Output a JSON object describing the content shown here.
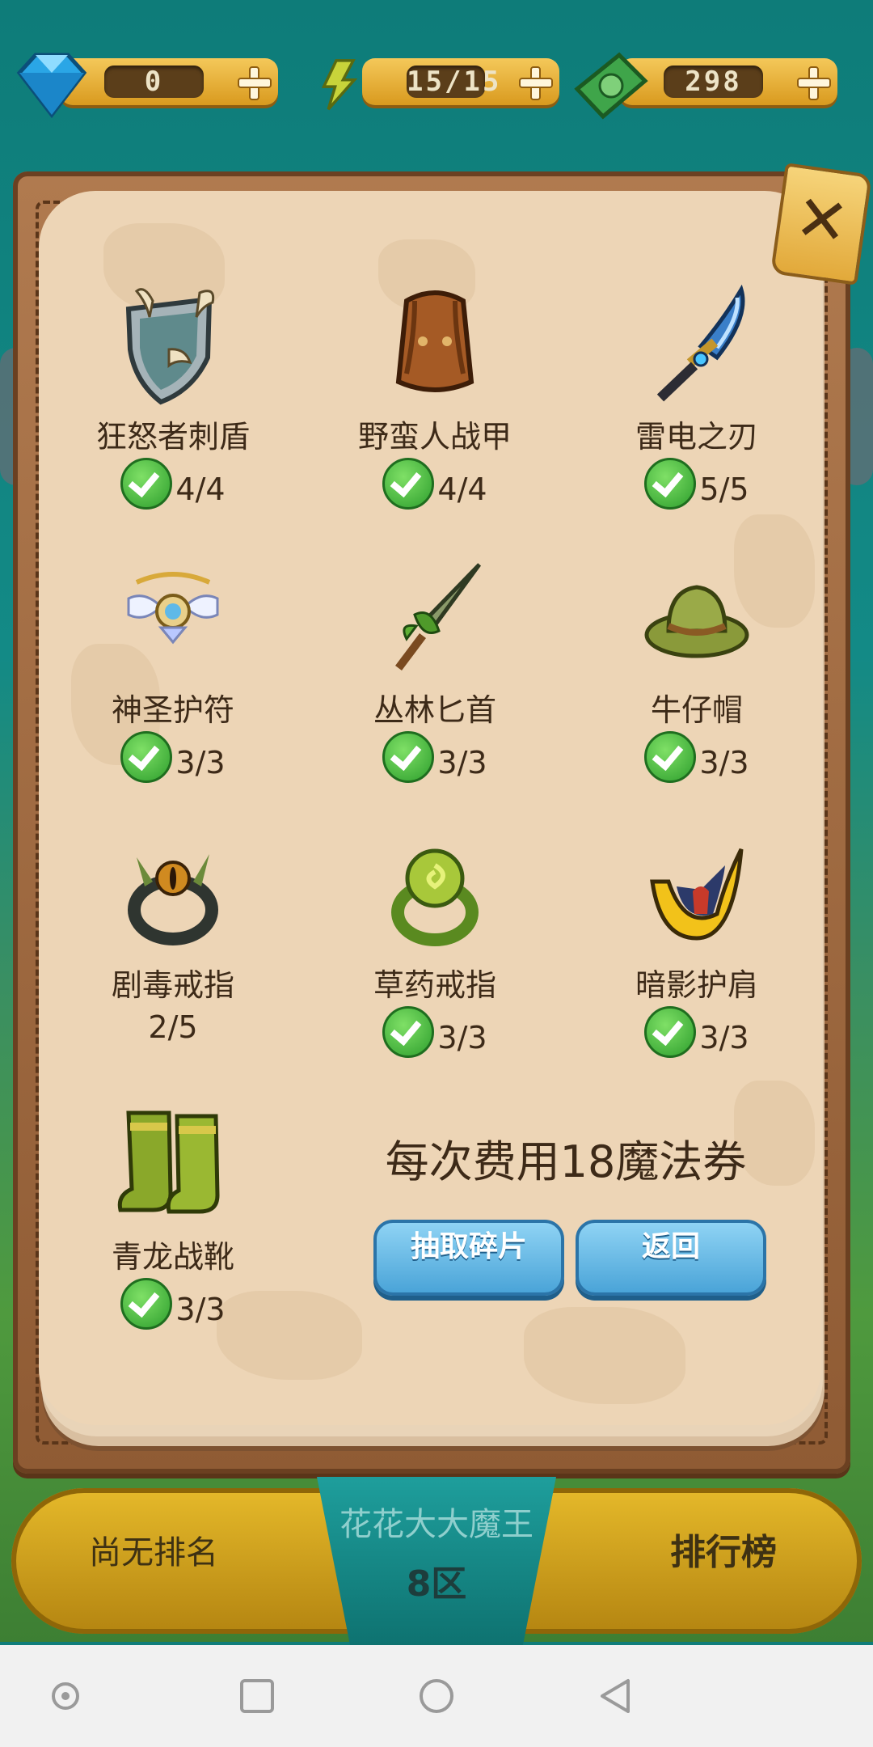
{
  "currencies": {
    "gems": "0",
    "energy": "15/15",
    "cash": "298"
  },
  "items": [
    {
      "name": "狂怒者刺盾",
      "progress": "4/4",
      "complete": true,
      "icon": "spiked-shield-icon"
    },
    {
      "name": "野蛮人战甲",
      "progress": "4/4",
      "complete": true,
      "icon": "leather-armor-icon"
    },
    {
      "name": "雷电之刃",
      "progress": "5/5",
      "complete": true,
      "icon": "lightning-blade-icon"
    },
    {
      "name": "神圣护符",
      "progress": "3/3",
      "complete": true,
      "icon": "holy-amulet-icon"
    },
    {
      "name": "丛林匕首",
      "progress": "3/3",
      "complete": true,
      "icon": "jungle-dagger-icon"
    },
    {
      "name": "牛仔帽",
      "progress": "3/3",
      "complete": true,
      "icon": "cowboy-hat-icon"
    },
    {
      "name": "剧毒戒指",
      "progress": "2/5",
      "complete": false,
      "icon": "poison-ring-icon"
    },
    {
      "name": "草药戒指",
      "progress": "3/3",
      "complete": true,
      "icon": "herb-ring-icon"
    },
    {
      "name": "暗影护肩",
      "progress": "3/3",
      "complete": true,
      "icon": "shadow-pauldron-icon"
    },
    {
      "name": "青龙战靴",
      "progress": "3/3",
      "complete": true,
      "icon": "green-boots-icon"
    }
  ],
  "cost_text": "每次费用18魔法券",
  "buttons": {
    "draw": "抽取碎片",
    "back": "返回"
  },
  "ranking": {
    "left": "尚无排名",
    "player_name": "花花大大魔王",
    "zone": "8区",
    "right": "排行榜"
  },
  "colors": {
    "panel_paper": "#edd5b6",
    "accent_blue": "#4aa4d8",
    "gold": "#e5b92a",
    "teal": "#0f7d7a"
  }
}
